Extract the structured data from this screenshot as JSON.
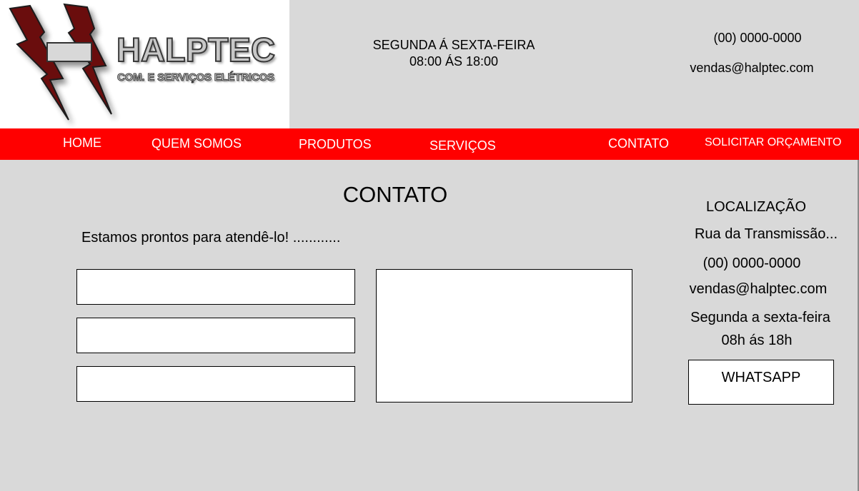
{
  "brand": {
    "name": "HALPTEC",
    "tagline": "COM. E SERVIÇOS ELÉTRICOS",
    "logo_colors": {
      "bolt": "#6b0a0f",
      "text_fill": "#c8c8c8",
      "text_outline": "#3a3a3a"
    }
  },
  "header": {
    "hours_line1": "SEGUNDA Á SEXTA-FEIRA",
    "hours_line2": "08:00 ÁS 18:00",
    "phone": "(00) 0000-0000",
    "email": "vendas@halptec.com"
  },
  "nav": {
    "background": "#ff0000",
    "items": [
      {
        "label": "HOME"
      },
      {
        "label": "QUEM SOMOS"
      },
      {
        "label": "PRODUTOS"
      },
      {
        "label": "SERVIÇOS"
      },
      {
        "label": "CONTATO"
      },
      {
        "label": "SOLICITAR ORÇAMENTO"
      }
    ]
  },
  "main": {
    "title": "CONTATO",
    "intro": "Estamos prontos para atendê-lo! ............"
  },
  "form": {
    "fields": [
      {
        "value": "",
        "placeholder": ""
      },
      {
        "value": "",
        "placeholder": ""
      },
      {
        "value": "",
        "placeholder": ""
      }
    ],
    "message": {
      "value": "",
      "placeholder": ""
    }
  },
  "aside": {
    "heading": "LOCALIZAÇÃO",
    "address": "Rua da Transmissão...",
    "phone": "(00) 0000-0000",
    "email": "vendas@halptec.com",
    "days": "Segunda a sexta-feira",
    "hours": "08h ás 18h",
    "whatsapp_label": "WHATSAPP"
  }
}
